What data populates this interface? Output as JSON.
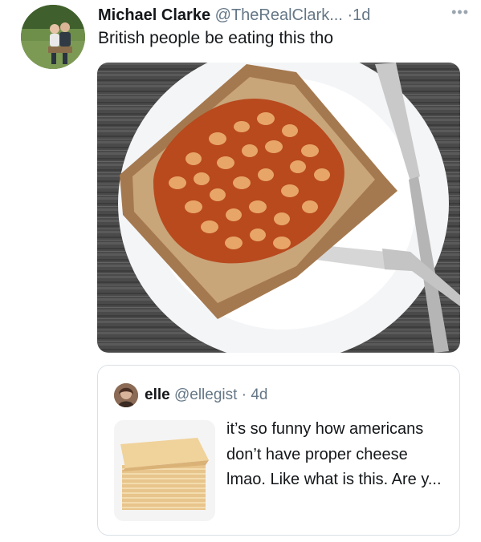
{
  "tweet": {
    "author_name": "Michael Clarke",
    "author_handle": "@TheRealClark...",
    "separator": "·",
    "time": "1d",
    "more_icon": "more-dots-icon",
    "text": "British people be eating this tho",
    "avatar_icon": "profile-photo",
    "media_icon": "beans-on-toast-photo"
  },
  "quote": {
    "author_name": "elle",
    "author_handle": "@ellegist",
    "separator": "·",
    "time": "4d",
    "avatar_icon": "profile-photo",
    "thumbnail_icon": "cheese-slices-photo",
    "text": "it’s so funny how americans don’t have proper cheese lmao. Like what is this. Are y..."
  },
  "colors": {
    "secondary_text": "#657786",
    "border": "#d9e0e6"
  }
}
